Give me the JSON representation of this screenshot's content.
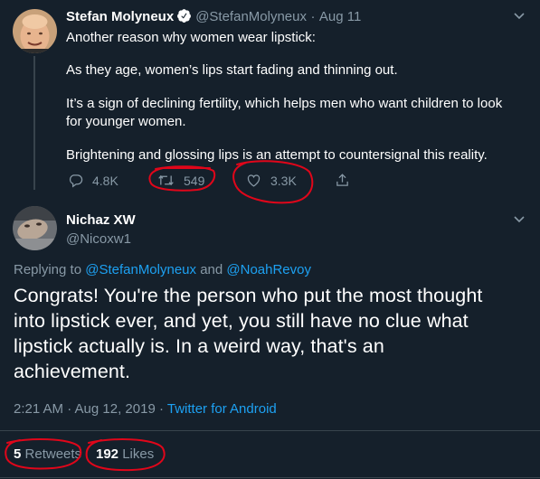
{
  "parent_tweet": {
    "display_name": "Stefan Molyneux",
    "handle": "@StefanMolyneux",
    "separator": "·",
    "date": "Aug 11",
    "paragraphs": [
      "Another reason why women wear lipstick:",
      "As they age, women’s lips start fading and thinning out.",
      "It’s a sign of declining fertility, which helps men who want children to look",
      "for younger women.",
      "Brightening and glossing lips is an attempt to countersignal this reality."
    ],
    "actions": {
      "replies": "4.8K",
      "retweets": "549",
      "likes": "3.3K"
    }
  },
  "reply_tweet": {
    "display_name": "Nichaz XW",
    "handle": "@Nicoxw1",
    "replying_prefix": "Replying to",
    "replying_user_1": "@StefanMolyneux",
    "replying_and": "and",
    "replying_user_2": "@NoahRevoy",
    "lines": [
      "Congrats! You're the person who put the most thought",
      "into lipstick ever, and yet, you still have no clue what",
      "lipstick actually is. In a weird way, that's an",
      "achievement."
    ],
    "timestamp": "2:21 AM · Aug 12, 2019 ·",
    "source": "Twitter for Android",
    "stats": {
      "retweets_count": "5",
      "retweets_label": "Retweets",
      "likes_count": "192",
      "likes_label": "Likes"
    }
  },
  "colors": {
    "background": "#15202b",
    "muted": "#8899a6",
    "link": "#1da1f2",
    "annotation": "#e0061a"
  }
}
